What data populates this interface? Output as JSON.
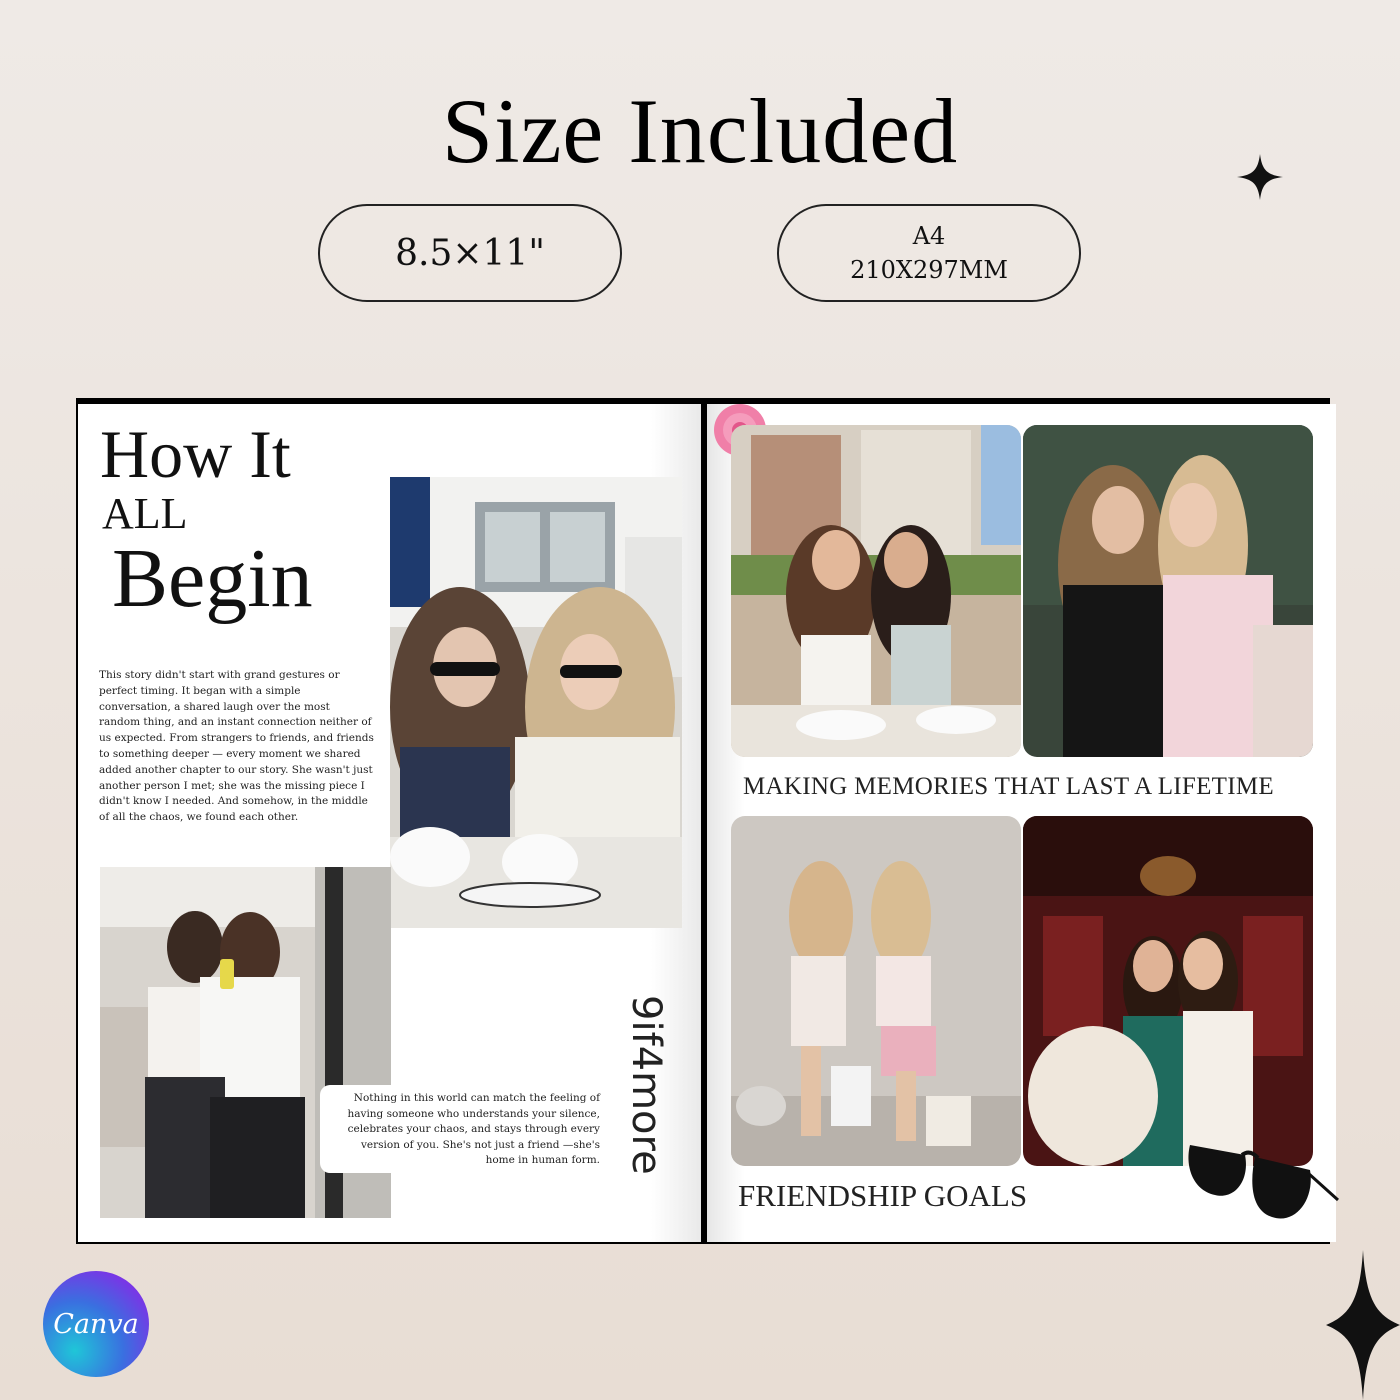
{
  "header": {
    "title": "Size Included"
  },
  "sizes": [
    {
      "line1": "8.5×11\"",
      "line2": ""
    },
    {
      "line1": "A4",
      "line2": "210X297MM"
    }
  ],
  "left_page": {
    "heading_line1": "How It",
    "heading_line2": "ALL",
    "heading_line3": "Begin",
    "story": "This story didn't start with grand gestures or perfect timing. It began with a simple conversation, a shared laugh over the most random thing, and an instant connection neither of us expected. From strangers to friends, and friends to something deeper — every moment we shared added another chapter to our story. She wasn't just another person I met; she was the missing piece I didn't know I needed. And somehow, in the middle of all the chaos, we found each other.",
    "quote": "Nothing in this world can match the feeling of having someone who understands your silence, celebrates your chaos, and stays through every version of you. She's not just a friend —she's home in human form.",
    "vertical_script": "9if4more"
  },
  "right_page": {
    "caption_top": "MAKING MEMORIES THAT LAST A LIFETIME",
    "caption_bottom": "FRIENDSHIP GOALS"
  },
  "brand": {
    "logo_text": "Canva"
  },
  "colors": {
    "background_top": "#efeae6",
    "background_bottom": "#e8ddd4",
    "text": "#111111",
    "canva_gradient_start": "#1fc6d8",
    "canva_gradient_end": "#8a2be2"
  }
}
